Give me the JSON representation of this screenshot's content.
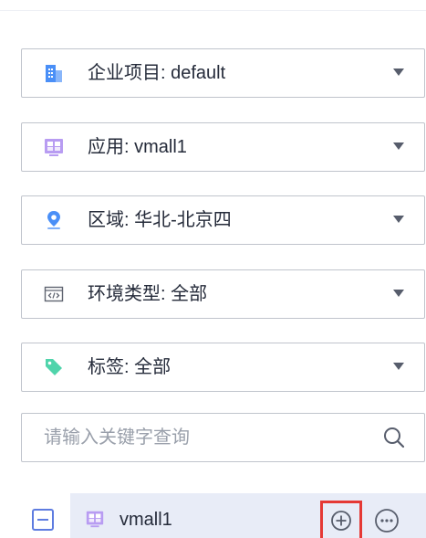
{
  "filters": {
    "enterprise_project": {
      "label": "企业项目:",
      "value": "default",
      "icon": "enterprise-building-icon"
    },
    "application": {
      "label": "应用:",
      "value": "vmall1",
      "icon": "application-icon"
    },
    "region": {
      "label": "区域:",
      "value": "华北-北京四",
      "icon": "location-pin-icon"
    },
    "environment_type": {
      "label": "环境类型:",
      "value": "全部",
      "icon": "code-window-icon"
    },
    "tags": {
      "label": "标签:",
      "value": "全部",
      "icon": "tag-icon"
    }
  },
  "search": {
    "placeholder": "请输入关键字查询",
    "value": "",
    "icon": "search-icon"
  },
  "tree": {
    "node": {
      "label": "vmall1",
      "icon": "application-icon"
    },
    "collapse_icon": "minus-square-icon",
    "add_icon": "plus-circle-icon",
    "more_icon": "more-circle-icon",
    "highlight_color": "#e53935"
  },
  "colors": {
    "border": "#c0c4cc",
    "text": "#252b3a",
    "accent": "#5e7ce0",
    "selected_bg": "#e8ecf7"
  }
}
